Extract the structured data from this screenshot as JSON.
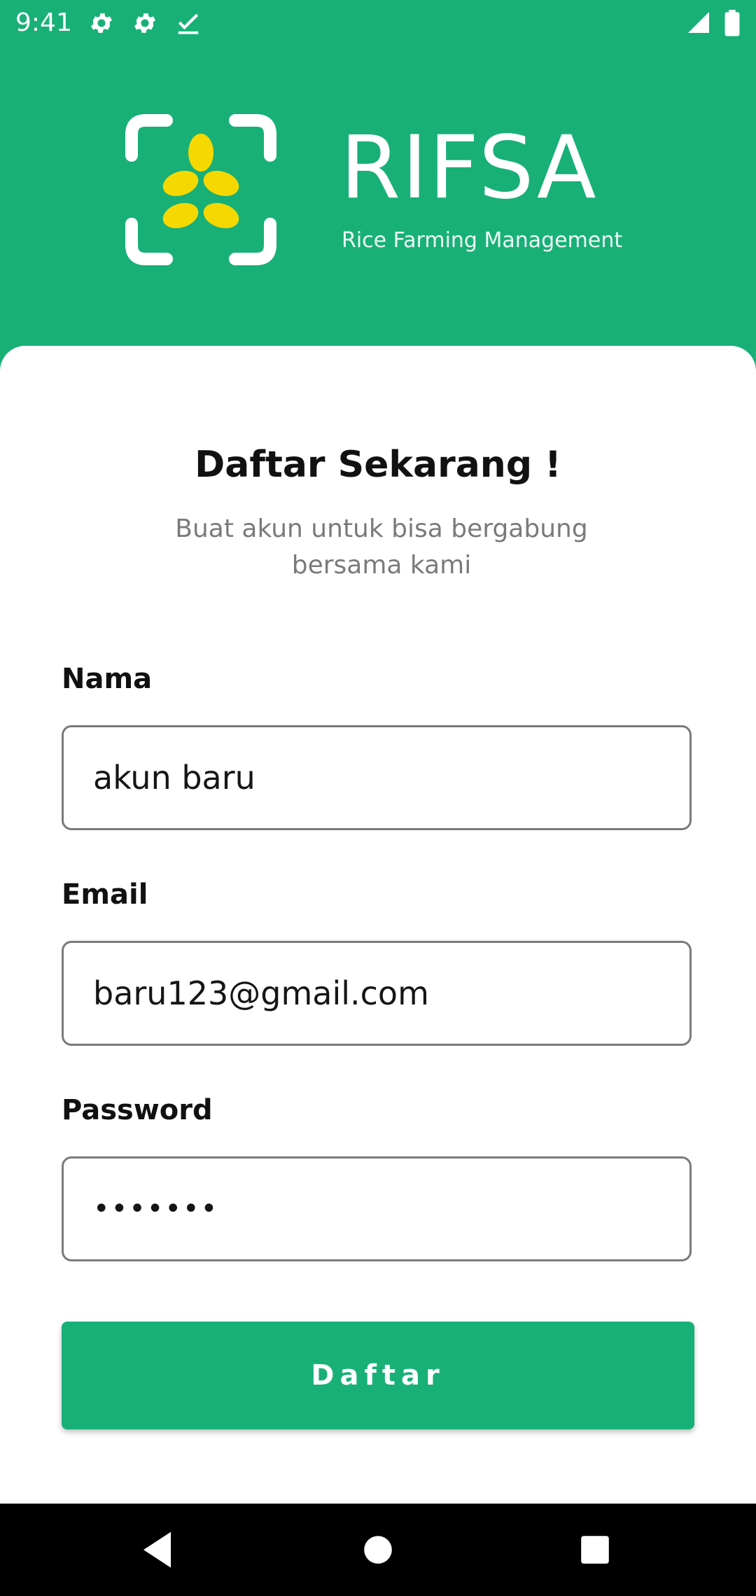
{
  "status_bar": {
    "time": "9:41",
    "icons": [
      "settings-icon",
      "settings-icon",
      "check-icon",
      "signal-icon",
      "battery-icon"
    ]
  },
  "header": {
    "logo_icon": "rice-scan-icon",
    "brand_title": "RIFSA",
    "brand_subtitle": "Rice Farming Management"
  },
  "form": {
    "title": "Daftar Sekarang !",
    "subtitle": "Buat akun untuk bisa bergabung bersama kami",
    "name_label": "Nama",
    "name_value": "akun baru",
    "email_label": "Email",
    "email_value": "baru123@gmail.com",
    "password_label": "Password",
    "password_value": "•••••••",
    "submit_label": "Daftar"
  },
  "nav": {
    "icons": [
      "back-icon",
      "home-icon",
      "recents-icon"
    ]
  },
  "colors": {
    "primary": "#18b077",
    "logo_grain": "#f5d800",
    "text_dark": "#111111",
    "text_muted": "#7a7a7a"
  }
}
